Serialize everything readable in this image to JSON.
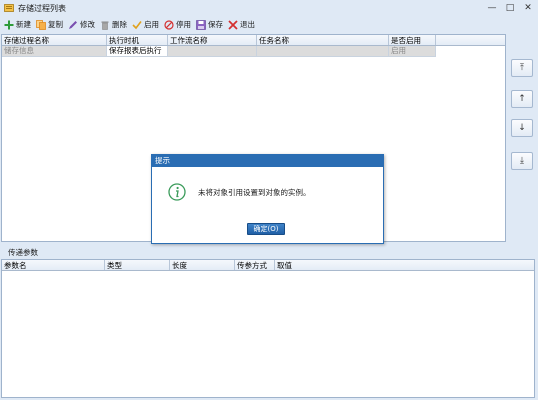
{
  "window": {
    "title": "存储过程列表",
    "controls": {
      "minimize": "—",
      "maximize": "□",
      "close": "✕"
    }
  },
  "toolbar": {
    "items": [
      {
        "label": "新建",
        "icon": "plus-icon",
        "color": "#2e9b3a"
      },
      {
        "label": "复制",
        "icon": "copy-icon",
        "color": "#e08a1e"
      },
      {
        "label": "修改",
        "icon": "edit-icon",
        "color": "#7a4fb0"
      },
      {
        "label": "删除",
        "icon": "trash-icon",
        "color": "#8a8a8a"
      },
      {
        "label": "启用",
        "icon": "check-icon",
        "color": "#e0a21e"
      },
      {
        "label": "停用",
        "icon": "ban-icon",
        "color": "#d43030"
      },
      {
        "label": "保存",
        "icon": "save-icon",
        "color": "#7a4fb0"
      },
      {
        "label": "退出",
        "icon": "close-icon",
        "color": "#d43030"
      }
    ]
  },
  "top_grid": {
    "columns": [
      "存储过程名称",
      "执行时机",
      "工作流名称",
      "任务名称",
      "是否启用"
    ],
    "rows": [
      [
        "储存信息",
        "保存报表后执行",
        "",
        "",
        "启用"
      ]
    ]
  },
  "side_buttons": [
    "⤒",
    "↑",
    "↓",
    "⤓"
  ],
  "bottom_panel": {
    "title": "传递参数",
    "columns": [
      "参数名",
      "类型",
      "长度",
      "传参方式",
      "取值"
    ]
  },
  "dialog": {
    "title": "提示",
    "message": "未将对象引用设置到对象的实例。",
    "icon": "info-icon",
    "ok_label": "确定(O)"
  },
  "colors": {
    "accent": "#2a6db3",
    "background": "#dfe9f5"
  }
}
